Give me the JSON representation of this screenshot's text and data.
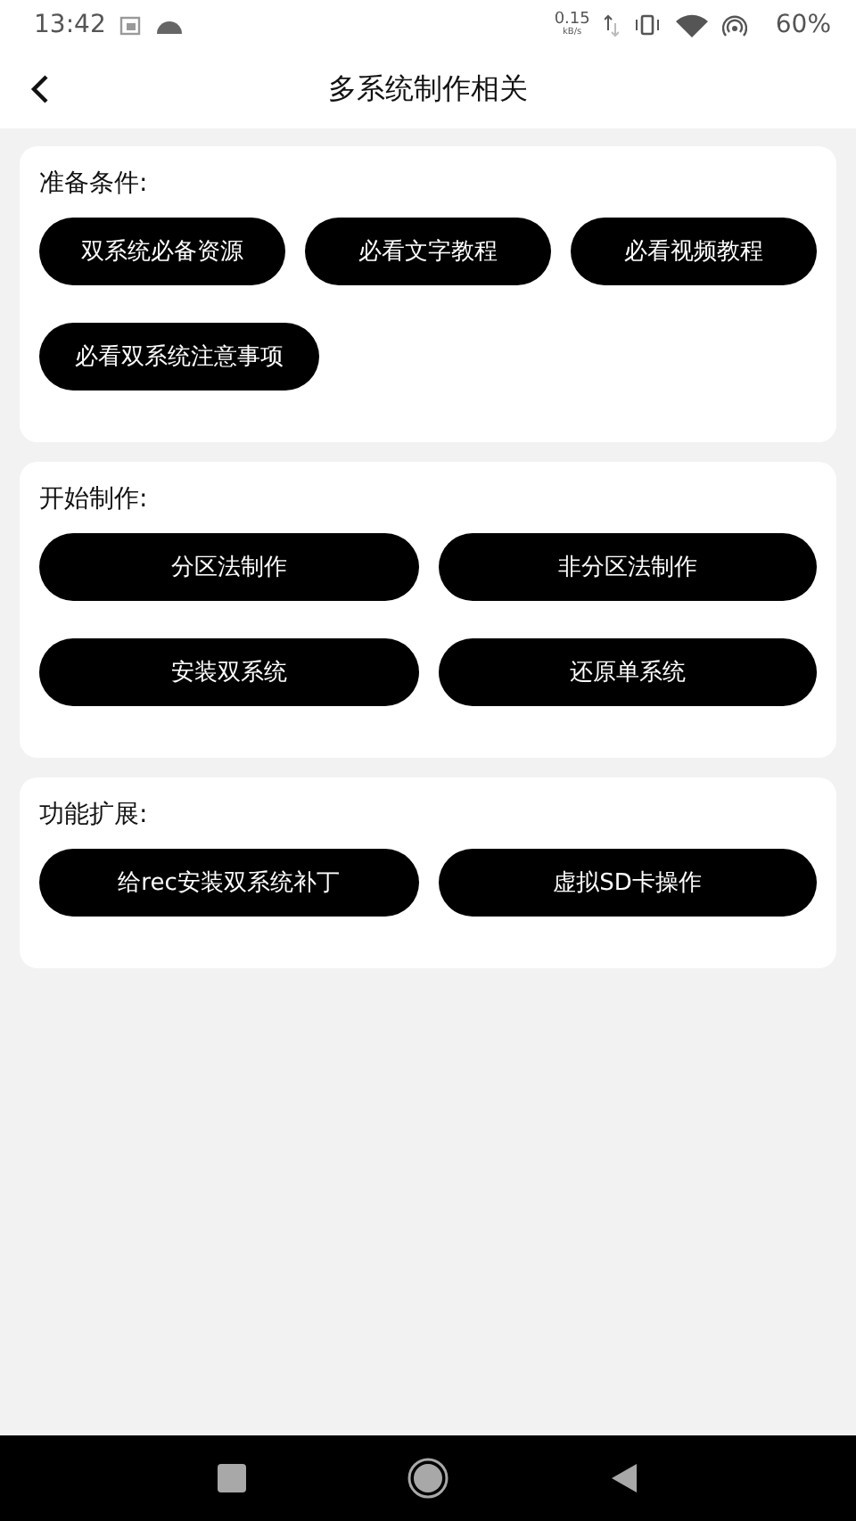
{
  "status_bar": {
    "time": "13:42",
    "speed": "0.15",
    "speed_unit": "kB/s",
    "battery": "60%"
  },
  "header": {
    "title": "多系统制作相关"
  },
  "sections": [
    {
      "title": "准备条件:",
      "kind": "wrap",
      "buttons": [
        "双系统必备资源",
        "必看文字教程",
        "必看视频教程",
        "必看双系统注意事项"
      ]
    },
    {
      "title": "开始制作:",
      "kind": "grid",
      "buttons": [
        "分区法制作",
        "非分区法制作",
        "安装双系统",
        "还原单系统"
      ]
    },
    {
      "title": "功能扩展:",
      "kind": "grid",
      "buttons": [
        "给rec安装双系统补丁",
        "虚拟SD卡操作"
      ]
    }
  ]
}
